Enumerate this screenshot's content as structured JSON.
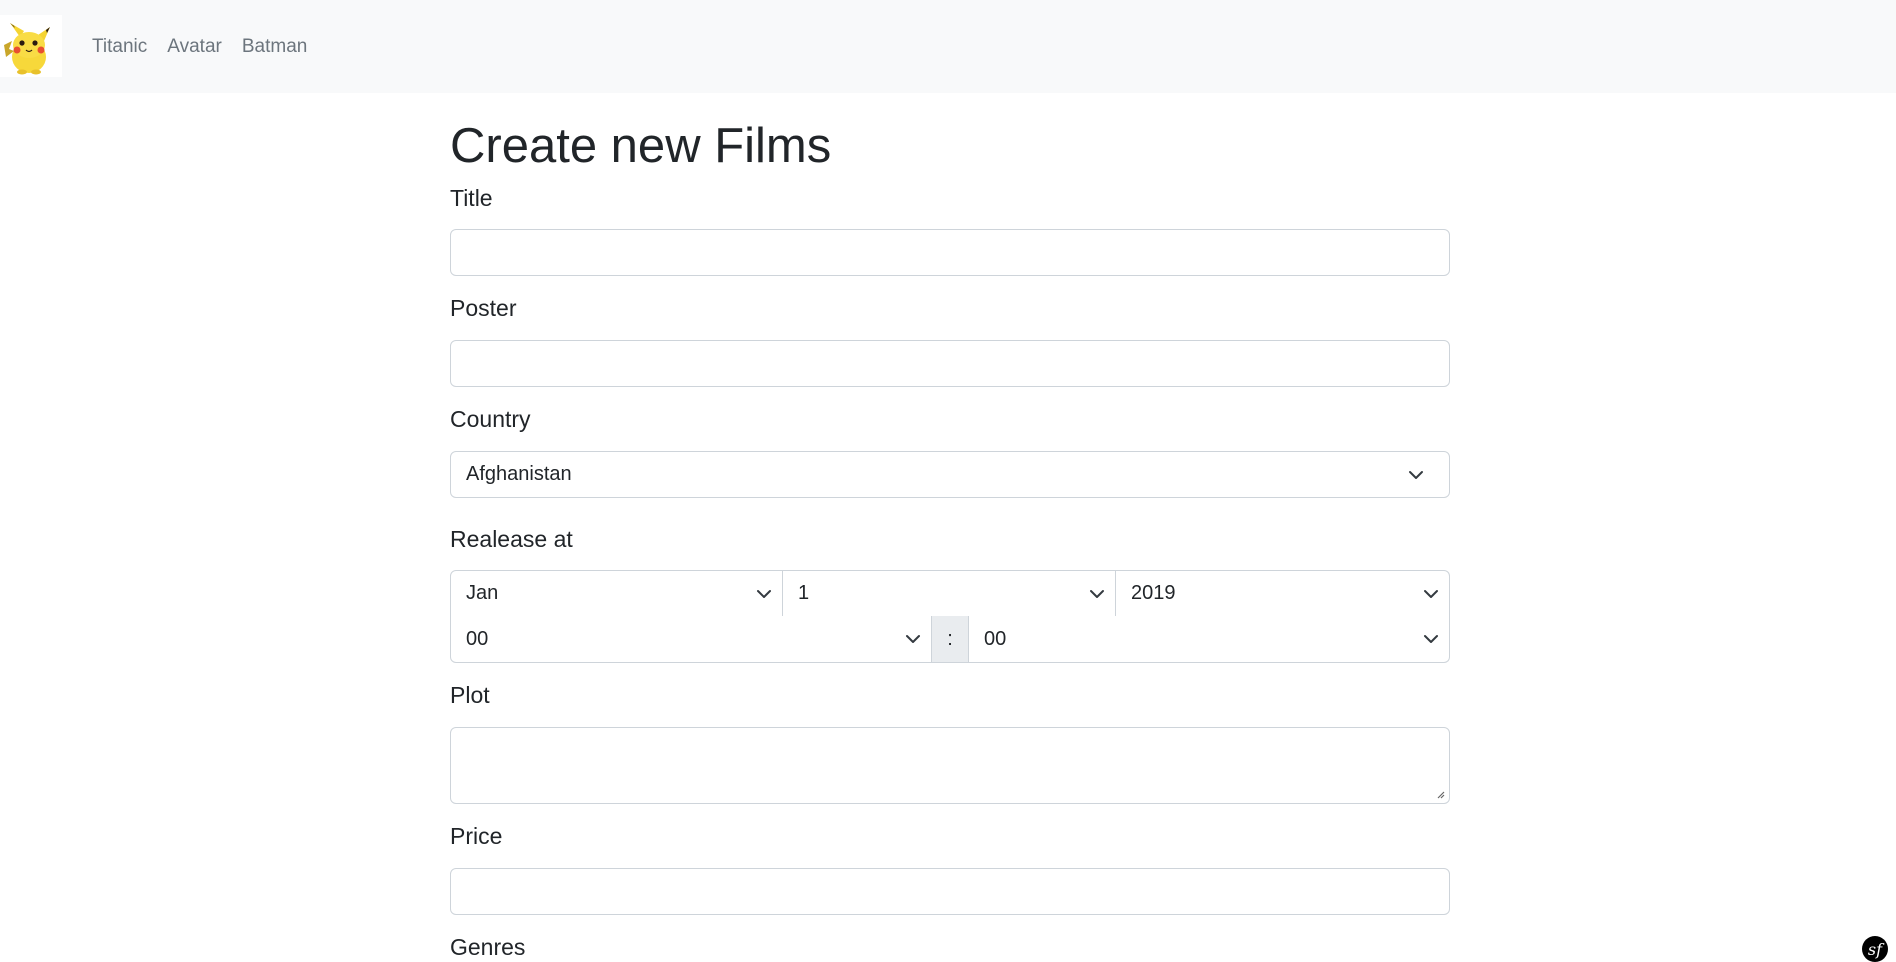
{
  "nav": {
    "logo_alt": "Pikachu",
    "links": [
      "Titanic",
      "Avatar",
      "Batman"
    ]
  },
  "page": {
    "title": "Create new Films"
  },
  "form": {
    "title_label": "Title",
    "title_value": "",
    "poster_label": "Poster",
    "poster_value": "",
    "country_label": "Country",
    "country_value": "Afghanistan",
    "release_label": "Realease at",
    "release_month": "Jan",
    "release_day": "1",
    "release_year": "2019",
    "release_hour": "00",
    "time_separator": ":",
    "release_minute": "00",
    "plot_label": "Plot",
    "plot_value": "",
    "price_label": "Price",
    "price_value": "",
    "genres_label": "Genres"
  },
  "toolbar": {
    "symfony_glyph": "sf"
  },
  "colors": {
    "navbar_bg": "#f8f9fa",
    "border": "#ced4da",
    "nav_link": "#6c757d",
    "text": "#212529"
  }
}
